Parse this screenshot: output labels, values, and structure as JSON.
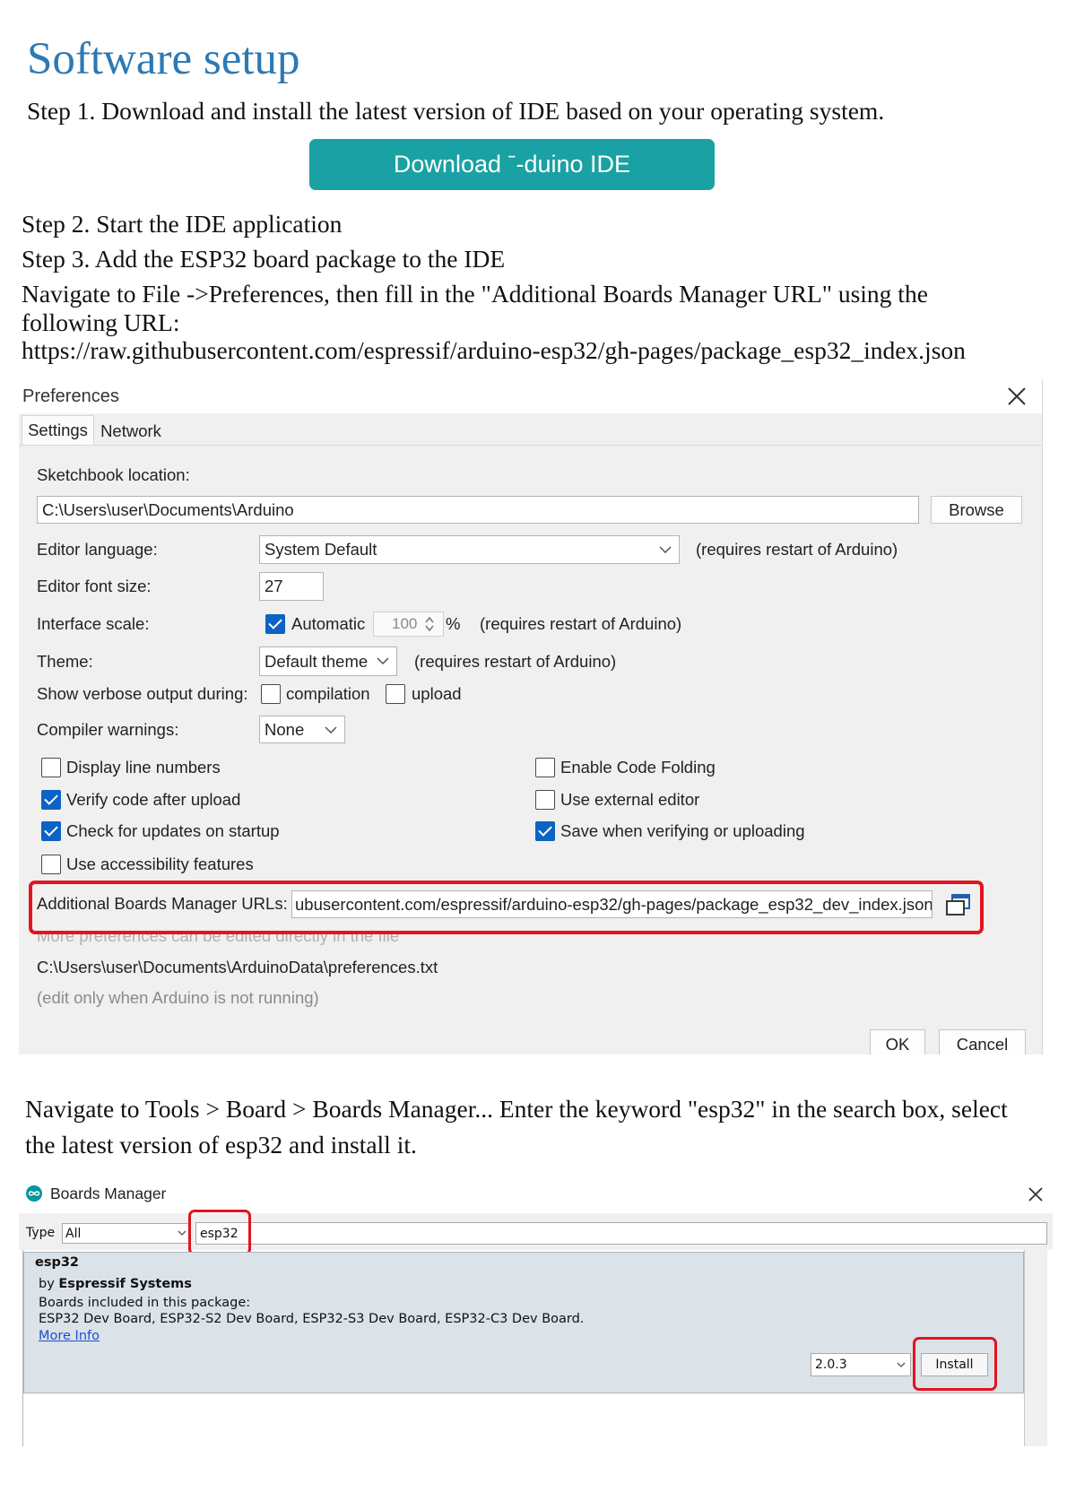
{
  "page": {
    "title": "Software setup",
    "step1": "Step 1. Download and install the latest version of IDE based on your operating system.",
    "download_button": "Download ˉ-duino IDE",
    "step2": "Step 2. Start the IDE application",
    "step3": "Step 3. Add the ESP32 board package to the IDE",
    "navigate_file_lines": [
      "Navigate to File ->Preferences, then fill in the \"Additional Boards Manager URL\" using the",
      "following URL:"
    ],
    "board_url": "https://raw.githubusercontent.com/espressif/arduino-esp32/gh-pages/package_esp32_index.json",
    "navigate_tools_lines": [
      "Navigate to Tools > Board > Boards Manager... Enter the keyword \"esp32\" in the search box, select",
      "the latest version of esp32 and install it."
    ]
  },
  "colors": {
    "title": "#2c79b5",
    "download_button": "#19a1a3",
    "highlight": "#e3141f",
    "checkbox_checked": "#0c63c4",
    "link": "#1a4fd0"
  },
  "preferences": {
    "window_title": "Preferences",
    "close_icon": "close-icon",
    "tabs": [
      "Settings",
      "Network"
    ],
    "active_tab": "Settings",
    "sketchbook_label": "Sketchbook location:",
    "sketchbook_path": "C:\\Users\\user\\Documents\\Arduino",
    "browse_button": "Browse",
    "editor_language_label": "Editor language:",
    "editor_language_value": "System Default",
    "restart_note": "(requires restart of Arduino)",
    "font_size_label": "Editor font size:",
    "font_size_value": "27",
    "interface_scale_label": "Interface scale:",
    "automatic_label": "Automatic",
    "automatic_checked": true,
    "scale_value": "100",
    "scale_unit": "%",
    "theme_label": "Theme:",
    "theme_value": "Default theme",
    "verbose_label": "Show verbose output during:",
    "verbose_options": [
      {
        "label": "compilation",
        "checked": false
      },
      {
        "label": "upload",
        "checked": false
      }
    ],
    "compiler_warnings_label": "Compiler warnings:",
    "compiler_warnings_value": "None",
    "options_left": [
      {
        "label": "Display line numbers",
        "checked": false
      },
      {
        "label": "Verify code after upload",
        "checked": true
      },
      {
        "label": "Check for updates on startup",
        "checked": true
      },
      {
        "label": "Use accessibility features",
        "checked": false
      }
    ],
    "options_right": [
      {
        "label": "Enable Code Folding",
        "checked": false
      },
      {
        "label": "Use external editor",
        "checked": false
      },
      {
        "label": "Save when verifying or uploading",
        "checked": true
      }
    ],
    "boards_urls_label": "Additional Boards Manager URLs:",
    "boards_urls_value": "ubusercontent.com/espressif/arduino-esp32/gh-pages/package_esp32_dev_index.json",
    "more_prefs_note": "More preferences can be edited directly in the file",
    "prefs_file_path": "C:\\Users\\user\\Documents\\ArduinoData\\preferences.txt",
    "edit_note": "(edit only when Arduino is not running)",
    "ok_button": "OK",
    "cancel_button": "Cancel"
  },
  "boards_manager": {
    "window_title": "Boards Manager",
    "logo_icon": "arduino-logo-icon",
    "type_label": "Type",
    "type_value": "All",
    "search_value": "esp32",
    "item": {
      "name": "esp32",
      "by": "by",
      "author": "Espressif Systems",
      "boards_heading": "Boards included in this package:",
      "boards_list": "ESP32 Dev Board, ESP32-S2 Dev Board, ESP32-S3 Dev Board, ESP32-C3 Dev Board.",
      "more_info": "More Info",
      "version": "2.0.3",
      "install_button": "Install"
    }
  }
}
